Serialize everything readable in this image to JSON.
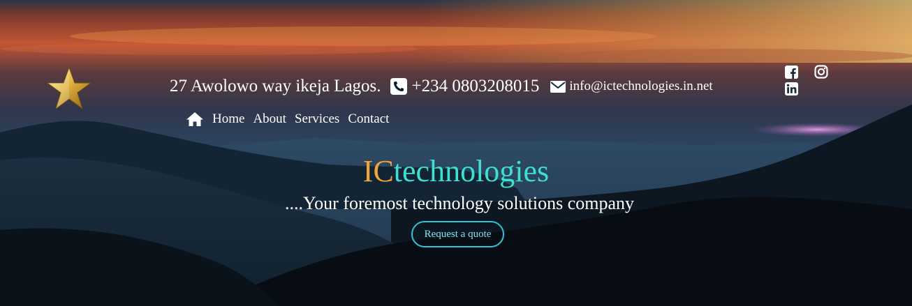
{
  "header": {
    "address": "27 Awolowo way ikeja Lagos.",
    "phone": "+234 0803208015",
    "email": "info@ictechnologies.in.net",
    "phone_icon": "phone-square-icon",
    "email_icon": "envelope-icon"
  },
  "logo": {
    "icon": "gold-star-icon"
  },
  "social": {
    "facebook_icon": "facebook-icon",
    "instagram_icon": "instagram-icon",
    "linkedin_icon": "linkedin-icon"
  },
  "nav": {
    "home_icon": "home-icon",
    "items": [
      "Home",
      "About",
      "Services",
      "Contact"
    ]
  },
  "hero": {
    "brand_prefix": "IC",
    "brand_suffix": "technologies",
    "tagline": "....Your foremost technology solutions company",
    "cta_label": "Request a quote"
  },
  "colors": {
    "brand_prefix": "#f2a43a",
    "brand_suffix": "#3ee0cf",
    "cta_border": "#34c3d6",
    "text": "#ffffff"
  }
}
